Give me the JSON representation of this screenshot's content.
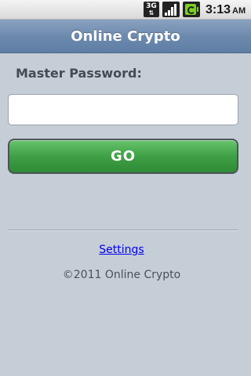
{
  "status_bar": {
    "network_label": "3G",
    "network_icon": "3g-network-icon",
    "signal_icon": "signal-strength-icon",
    "battery_icon": "battery-charging-icon",
    "time": "3:13",
    "ampm": "AM"
  },
  "app": {
    "title": "Online Crypto"
  },
  "form": {
    "label": "Master Password:",
    "password_value": "",
    "go_label": "GO"
  },
  "footer": {
    "settings_label": "Settings",
    "copyright": "©2011 Online Crypto"
  },
  "colors": {
    "title_bar": "#6d8aae",
    "background": "#c5cdd6",
    "go_button": "#3fa046",
    "link": "#0000ee"
  }
}
